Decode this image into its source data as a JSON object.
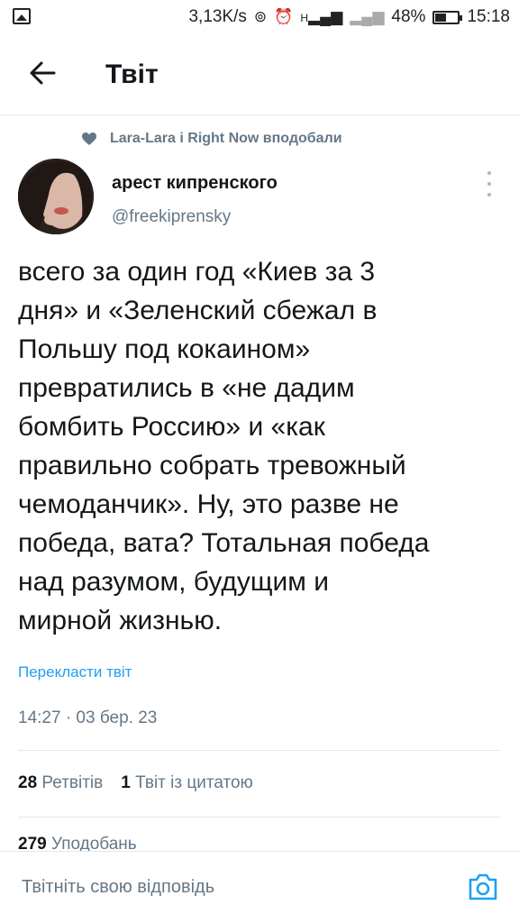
{
  "status_bar": {
    "speed": "3,13K/s",
    "network": "H",
    "battery": "48%",
    "time": "15:18"
  },
  "header": {
    "title": "Твіт"
  },
  "liked_by": "Lara-Lara і Right Now вподобали",
  "author": {
    "name": "арест кипренского",
    "handle": "@freekiprensky"
  },
  "tweet": {
    "text": "всего за один год «Киев за 3\nдня» и «Зеленский сбежал в\nПольшу под кокаином»\nпревратились в «не дадим\nбомбить Россию» и «как\nправильно собрать тревожный\nчемоданчик». Ну, это разве не\nпобеда, вата? Тотальная победа\nнад разумом, будущим и\nмирной жизнью.",
    "translate_label": "Перекласти твіт",
    "timestamp": "14:27 · 03 бер. 23"
  },
  "stats": {
    "retweets_count": "28",
    "retweets_label": "Ретвітів",
    "quotes_count": "1",
    "quotes_label": "Твіт із цитатою",
    "likes_count": "279",
    "likes_label": "Уподобань"
  },
  "reply": {
    "placeholder": "Твітніть свою відповідь"
  },
  "colors": {
    "accent": "#1da1f2",
    "secondary_text": "#657786",
    "divider": "#e1e8ed"
  }
}
